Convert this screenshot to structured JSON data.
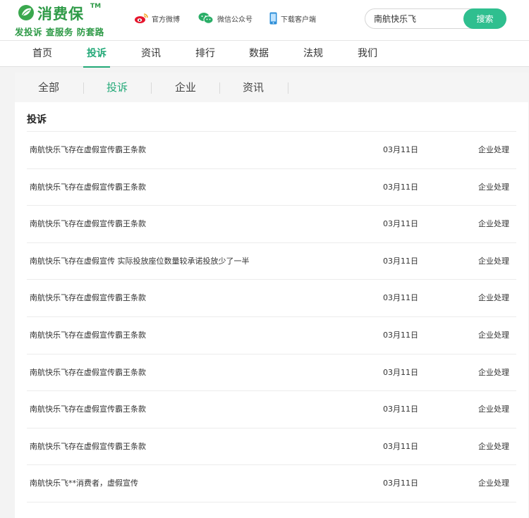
{
  "header": {
    "brand": "消费保",
    "trademark": "TM",
    "slogan": "发投诉 查服务 防套路",
    "links": [
      {
        "label": "官方微博",
        "icon": "weibo-icon"
      },
      {
        "label": "微信公众号",
        "icon": "wechat-icon"
      },
      {
        "label": "下载客户端",
        "icon": "phone-icon"
      }
    ],
    "search": {
      "value": "南航快乐飞",
      "button_label": "搜索"
    }
  },
  "nav": {
    "items": [
      "首页",
      "投诉",
      "资讯",
      "排行",
      "数据",
      "法规",
      "我们"
    ],
    "active_index": 1
  },
  "tabs": {
    "items": [
      "全部",
      "投诉",
      "企业",
      "资讯"
    ],
    "active_index": 1
  },
  "section": {
    "title": "投诉"
  },
  "complaints": [
    {
      "title": "南航快乐飞存在虚假宣传霸王条款",
      "date": "03月11日",
      "status": "企业处理"
    },
    {
      "title": "南航快乐飞存在虚假宣传霸王条款",
      "date": "03月11日",
      "status": "企业处理"
    },
    {
      "title": "南航快乐飞存在虚假宣传霸王条款",
      "date": "03月11日",
      "status": "企业处理"
    },
    {
      "title": "南航快乐飞存在虚假宣传 实际投放座位数量较承诺投放少了一半",
      "date": "03月11日",
      "status": "企业处理"
    },
    {
      "title": "南航快乐飞存在虚假宣传霸王条款",
      "date": "03月11日",
      "status": "企业处理"
    },
    {
      "title": "南航快乐飞存在虚假宣传霸王条款",
      "date": "03月11日",
      "status": "企业处理"
    },
    {
      "title": "南航快乐飞存在虚假宣传霸王条款",
      "date": "03月11日",
      "status": "企业处理"
    },
    {
      "title": "南航快乐飞存在虚假宣传霸王条款",
      "date": "03月11日",
      "status": "企业处理"
    },
    {
      "title": "南航快乐飞存在虚假宣传霸王条款",
      "date": "03月11日",
      "status": "企业处理"
    },
    {
      "title": "南航快乐飞**消费者，虚假宣传",
      "date": "03月11日",
      "status": "企业处理"
    }
  ],
  "colors": {
    "brand_green": "#2e9a47",
    "accent": "#23a978",
    "search_button": "#2fbf8f"
  }
}
